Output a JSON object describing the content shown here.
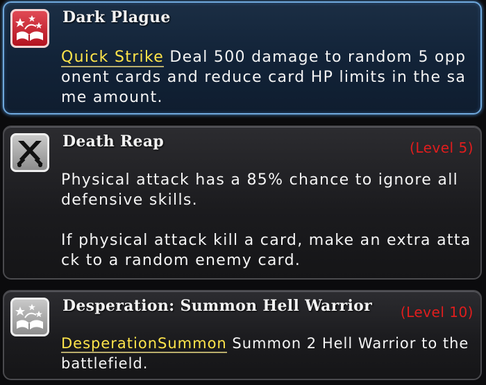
{
  "skills": [
    {
      "name": "Dark Plague",
      "icon": "spellbook-icon",
      "icon_color": "#c8202b",
      "keywords": [
        "Quick Strike"
      ],
      "description": "Deal 500 damage to random 5 opponent cards and reduce card HP limits in the same amount.",
      "selected": true
    },
    {
      "name": "Death Reap",
      "icon": "crossed-swords-icon",
      "icon_color": "#a8a8a8",
      "level": "(Level 5)",
      "paragraphs": [
        "Physical attack has a 85% chance to ignore all defensive skills.",
        "If physical attack kill a card, make an extra attack to a random enemy card."
      ]
    },
    {
      "name": "Desperation: Summon Hell Warrior",
      "icon": "spellbook-icon",
      "icon_color": "#a8a8a8",
      "level": "(Level 10)",
      "keywords": [
        "Desperation",
        "Summon"
      ],
      "description": "Summon 2 Hell Warrior to the battlefield."
    }
  ],
  "colors": {
    "keyword": "#ffe44a",
    "level": "#e01d1d",
    "selected_border": "#6fa8dc"
  }
}
